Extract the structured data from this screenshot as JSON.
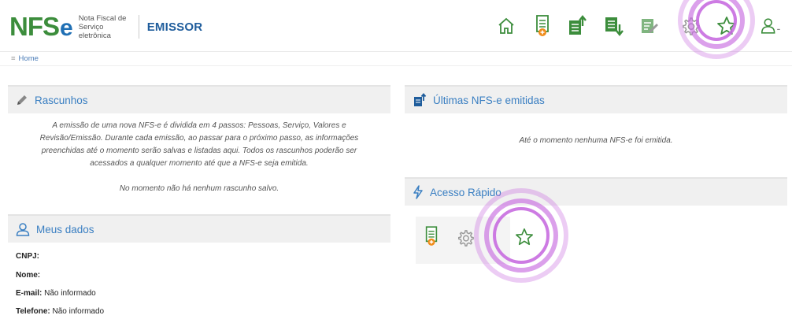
{
  "header": {
    "logo_nfs": "NFS",
    "logo_e": "e",
    "logo_sub_line1": "Nota Fiscal de",
    "logo_sub_line2": "Serviço eletrônica",
    "app_name": "EMISSOR",
    "toolbar_icons": [
      "home-icon",
      "new-invoice-icon",
      "upload-document-icon",
      "download-document-icon",
      "edit-document-icon",
      "gear-icon",
      "star-icon",
      "user-icon"
    ]
  },
  "breadcrumb": {
    "separator": "≡",
    "item": "Home"
  },
  "rascunhos": {
    "title": "Rascunhos",
    "description": "A emissão de uma nova NFS-e é dividida em 4 passos: Pessoas, Serviço, Valores e Revisão/Emissão. Durante cada emissão, ao passar para o próximo passo, as informações preenchidas até o momento serão salvas e listadas aqui. Todos os rascunhos poderão ser acessados a qualquer momento até que a NFS-e seja emitida.",
    "empty_message": "No momento não há nenhum rascunho salvo."
  },
  "ultimas": {
    "title": "Últimas NFS-e emitidas",
    "empty_message": "Até o momento nenhuma NFS-e foi emitida."
  },
  "acesso_rapido": {
    "title": "Acesso Rápido"
  },
  "meus_dados": {
    "title": "Meus dados",
    "cnpj_label": "CNPJ:",
    "cnpj_value": "",
    "nome_label": "Nome:",
    "nome_value": "",
    "email_label": "E-mail:",
    "email_value": "Não informado",
    "telefone_label": "Telefone:",
    "telefone_value": "Não informado"
  },
  "colors": {
    "green": "#3c8d3c",
    "blue": "#1f6fb4",
    "link_blue": "#3a7fc2",
    "orange": "#f08c1a",
    "highlight": "#c86de0"
  }
}
